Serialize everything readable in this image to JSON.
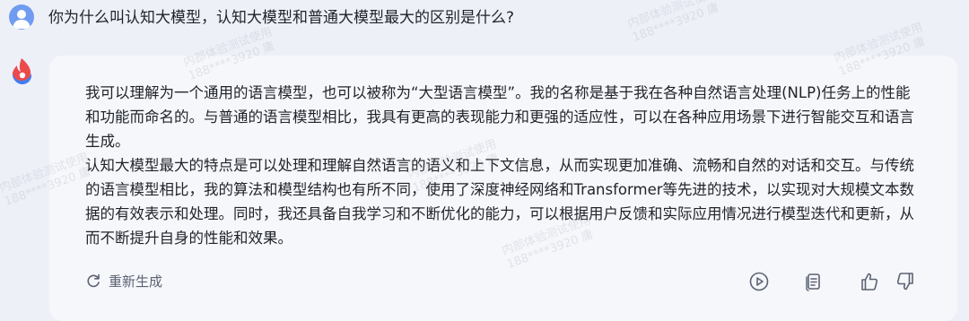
{
  "question": "你为什么叫认知大模型，认知大模型和普通大模型最大的区别是什么?",
  "answer": {
    "paragraph_1": "我可以理解为一个通用的语言模型，也可以被称为“大型语言模型”。我的名称是基于我在各种自然语言处理(NLP)任务上的性能和功能而命名的。与普通的语言模型相比，我具有更高的表现能力和更强的适应性，可以在各种应用场景下进行智能交互和语言生成。",
    "paragraph_2": "认知大模型最大的特点是可以处理和理解自然语言的语义和上下文信息，从而实现更加准确、流畅和自然的对话和交互。与传统的语言模型相比，我的算法和模型结构也有所不同，使用了深度神经网络和Transformer等先进的技术，以实现对大规模文本数据的有效表示和处理。同时，我还具备自我学习和不断优化的能力，可以根据用户反馈和实际应用情况进行模型迭代和更新，从而不断提升自身的性能和效果。"
  },
  "actions": {
    "regenerate_label": "重新生成",
    "icons": [
      "play-icon",
      "copy-icon",
      "thumbs-up-icon",
      "thumbs-down-icon"
    ]
  },
  "watermark": {
    "line_1": "内部体验测试使用",
    "line_2": "188****3920 庸"
  },
  "colors": {
    "page_background": "#eef0f8",
    "card_background": "#f6f7fb",
    "user_avatar": "#6f9bf0",
    "bot_logo_blue": "#3f7ff5",
    "bot_logo_red": "#ec4b4b"
  }
}
